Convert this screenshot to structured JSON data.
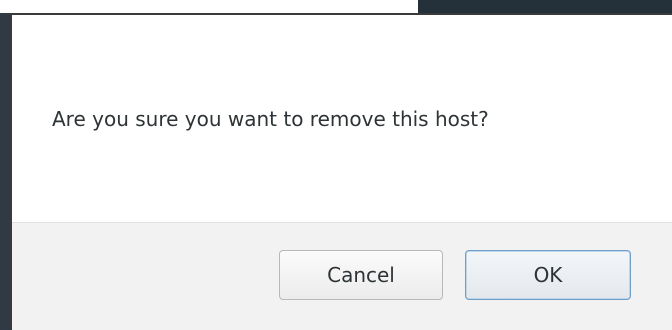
{
  "dialog": {
    "message": "Are you sure you want to remove this host?",
    "buttons": {
      "cancel_label": "Cancel",
      "ok_label": "OK"
    }
  },
  "colors": {
    "ok_focus_border": "#6f9ec8",
    "footer_background": "#f2f2f2",
    "text": "#2e3436"
  }
}
